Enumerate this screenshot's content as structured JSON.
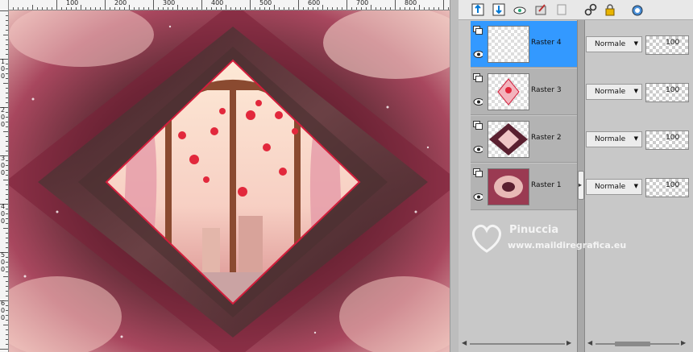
{
  "ruler_top": {
    "labels": [
      "100",
      "200",
      "300",
      "400",
      "500",
      "600",
      "700",
      "800"
    ]
  },
  "ruler_left": {
    "labels": [
      "100",
      "200",
      "300",
      "400",
      "500",
      "600"
    ]
  },
  "toolbar": {
    "icons": [
      "new-raster-layer-icon",
      "new-vector-layer-icon",
      "view-all-icon",
      "edit-layer-icon",
      "delete-layer-icon",
      "link-icon",
      "lock-icon",
      "mask-icon"
    ]
  },
  "layers": [
    {
      "name": "Raster 4",
      "blend": "Normale",
      "opacity": "100",
      "selected": true
    },
    {
      "name": "Raster 3",
      "blend": "Normale",
      "opacity": "100",
      "selected": false
    },
    {
      "name": "Raster 2",
      "blend": "Normale",
      "opacity": "100",
      "selected": false
    },
    {
      "name": "Raster 1",
      "blend": "Normale",
      "opacity": "100",
      "selected": false
    }
  ],
  "watermark": {
    "name": "Pinuccia",
    "site": "www.maildiregrafica.eu"
  },
  "colors": {
    "selected_layer": "#3399ff",
    "canvas_bg": "#6e1f33",
    "frame": "#d21e3c"
  }
}
